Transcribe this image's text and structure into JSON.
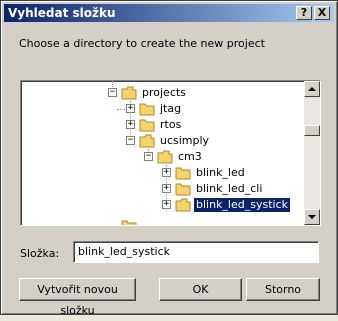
{
  "dialog": {
    "title": "Vyhledat složku",
    "help_label": "?",
    "close_label": "X",
    "prompt": "Choose a directory to create the new project"
  },
  "tree": {
    "items": [
      {
        "label": "projects",
        "expander": "−"
      },
      {
        "label": "jtag",
        "expander": "+"
      },
      {
        "label": "rtos",
        "expander": "+"
      },
      {
        "label": "ucsimply",
        "expander": "−"
      },
      {
        "label": "cm3",
        "expander": "−"
      },
      {
        "label": "blink_led",
        "expander": "+"
      },
      {
        "label": "blink_led_cli",
        "expander": "+"
      },
      {
        "label": "blink_led_systick",
        "expander": "+",
        "selected": true
      }
    ],
    "scroll_up_icon": "arrow-up",
    "scroll_down_icon": "arrow-down"
  },
  "folder_field": {
    "label": "Složka:",
    "value": "blink_led_systick"
  },
  "buttons": {
    "new_folder": "Vytvořit novou složku",
    "ok": "OK",
    "cancel": "Storno"
  },
  "colors": {
    "title_start": "#0a246a",
    "title_end": "#a6caf0",
    "selection": "#0a246a",
    "folder": "#f5d36a"
  }
}
